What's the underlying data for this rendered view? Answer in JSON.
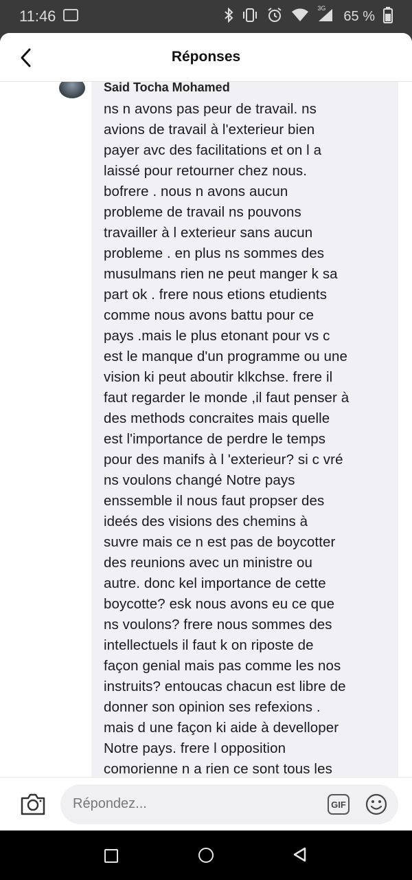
{
  "status_bar": {
    "time": "11:46",
    "network": "3G",
    "battery": "65 %"
  },
  "header": {
    "title": "Réponses"
  },
  "comment": {
    "author": "Said Tocha Mohamed",
    "text": "ns n avons pas peur de travail.  ns\navions de travail à l'exterieur bien\npayer avc des  facilitations et on l a\nlaissé pour retourner chez nous.\nbofrere . nous  n avons aucun\nprobleme de travail  ns pouvons\ntravailler à l exterieur sans aucun\nprobleme . en plus  ns sommes des\nmusulmans rien ne peut manger k sa\npart ok . frere nous etions etudients\ncomme  nous avons battu pour ce\npays .mais le plus etonant  pour vs c\nest le manque d'un programme ou une\nvision  ki peut aboutir klkchse.  frere il\nfaut regarder le monde ,il faut penser à\ndes methods concraites mais quelle\nest l'importance de perdre le temps\npour des manifs à l 'exterieur?  si c vré\nns voulons changé Notre  pays\nenssemble il nous faut propser des\nideés  des visions des chemins à\nsuvre mais ce n est pas de boycotter\ndes reunions avec un ministre ou\nautre.  donc kel importance de  cette\nboycotte? esk nous avons eu ce que\nns voulons? frere nous sommes  des\nintellectuels il faut k on riposte de\nfaçon genial mais pas comme les nos\ninstruits? entoucas chacun est libre de\ndonner son opinion ses refexions .\nmais d une façon ki aide à develloper\nNotre pays.  frere l opposition\ncomorienne n a rien ce sont tous les"
  },
  "reply_bar": {
    "placeholder": "Répondez...",
    "gif_label": "GIF"
  },
  "colors": {
    "status_bar_bg": "#3a3a3a",
    "bubble_bg": "#f1f1f5",
    "nav_bar_bg": "#000000"
  },
  "icons": [
    "bluetooth-icon",
    "vibrate-icon",
    "alarm-icon",
    "wifi-icon",
    "signal-icon",
    "battery-icon",
    "back-arrow-icon",
    "camera-icon",
    "gif-icon",
    "emoji-icon",
    "recents-icon",
    "home-icon",
    "nav-back-icon"
  ]
}
